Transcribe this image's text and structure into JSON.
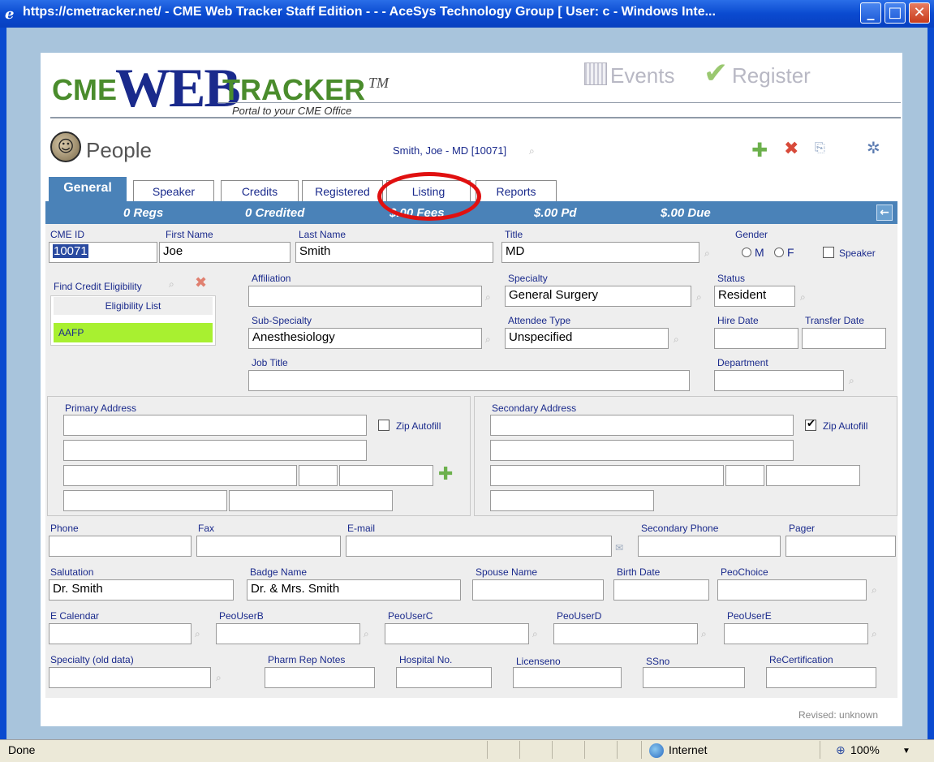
{
  "window": {
    "title": "https://cmetracker.net/ - CME Web Tracker Staff Edition - - - AceSys Technology Group [ User: c - Windows Inte..."
  },
  "logo": {
    "cme": "CME",
    "web": "WEB",
    "tracker": "TRACKER",
    "tm": "TM",
    "tagline": "Portal to your CME Office"
  },
  "topnav": {
    "events": "Events",
    "register": "Register"
  },
  "people": {
    "label": "People",
    "person": "Smith, Joe - MD [10071]"
  },
  "tabs": [
    "General",
    "Speaker",
    "Credits",
    "Registered",
    "Listing",
    "Reports"
  ],
  "stats": {
    "regs": "0 Regs",
    "credited": "0 Credited",
    "fees": "$.00 Fees",
    "pd": "$.00 Pd",
    "due": "$.00 Due"
  },
  "fields": {
    "cme_id": {
      "label": "CME ID",
      "value": "10071"
    },
    "first_name": {
      "label": "First Name",
      "value": "Joe"
    },
    "last_name": {
      "label": "Last Name",
      "value": "Smith"
    },
    "title": {
      "label": "Title",
      "value": "MD"
    },
    "gender": {
      "label": "Gender",
      "m": "M",
      "f": "F"
    },
    "speaker": {
      "label": "Speaker"
    },
    "find_credit": {
      "label": "Find Credit Eligibility"
    },
    "eligibility_list": {
      "label": "Eligibility List",
      "items": [
        "AAFP"
      ]
    },
    "affiliation": {
      "label": "Affiliation",
      "value": ""
    },
    "specialty": {
      "label": "Specialty",
      "value": "General Surgery"
    },
    "status": {
      "label": "Status",
      "value": "Resident"
    },
    "sub_specialty": {
      "label": "Sub-Specialty",
      "value": "Anesthesiology"
    },
    "attendee_type": {
      "label": "Attendee Type",
      "value": "Unspecified"
    },
    "hire_date": {
      "label": "Hire Date",
      "value": ""
    },
    "transfer_date": {
      "label": "Transfer Date",
      "value": ""
    },
    "job_title": {
      "label": "Job Title",
      "value": ""
    },
    "department": {
      "label": "Department",
      "value": ""
    },
    "primary_address": {
      "label": "Primary Address",
      "zip_autofill": "Zip Autofill"
    },
    "secondary_address": {
      "label": "Secondary Address",
      "zip_autofill": "Zip Autofill"
    },
    "phone": {
      "label": "Phone"
    },
    "fax": {
      "label": "Fax"
    },
    "email": {
      "label": "E-mail"
    },
    "secondary_phone": {
      "label": "Secondary Phone"
    },
    "pager": {
      "label": "Pager"
    },
    "salutation": {
      "label": "Salutation",
      "value": "Dr. Smith"
    },
    "badge_name": {
      "label": "Badge Name",
      "value": "Dr. & Mrs. Smith"
    },
    "spouse_name": {
      "label": "Spouse Name"
    },
    "birth_date": {
      "label": "Birth Date"
    },
    "peochoice": {
      "label": "PeoChoice"
    },
    "e_calendar": {
      "label": "E Calendar"
    },
    "peouserb": {
      "label": "PeoUserB"
    },
    "peouserc": {
      "label": "PeoUserC"
    },
    "peouserd": {
      "label": "PeoUserD"
    },
    "peousere": {
      "label": "PeoUserE"
    },
    "specialty_old": {
      "label": "Specialty (old data)"
    },
    "pharm_rep": {
      "label": "Pharm Rep Notes"
    },
    "hospital_no": {
      "label": "Hospital No."
    },
    "licenseno": {
      "label": "Licenseno"
    },
    "ssno": {
      "label": "SSno"
    },
    "recertification": {
      "label": "ReCertification"
    }
  },
  "revised": "Revised: unknown",
  "statusbar": {
    "status": "Done",
    "zone": "Internet",
    "zoom": "100%"
  },
  "icons": {
    "binoculars": "binoculars-icon",
    "add": "plus-icon",
    "delete": "x-icon"
  },
  "colors": {
    "tab_blue": "#4a82b8",
    "eligibility_green": "#a8f030",
    "annotation_red": "#e01010"
  }
}
